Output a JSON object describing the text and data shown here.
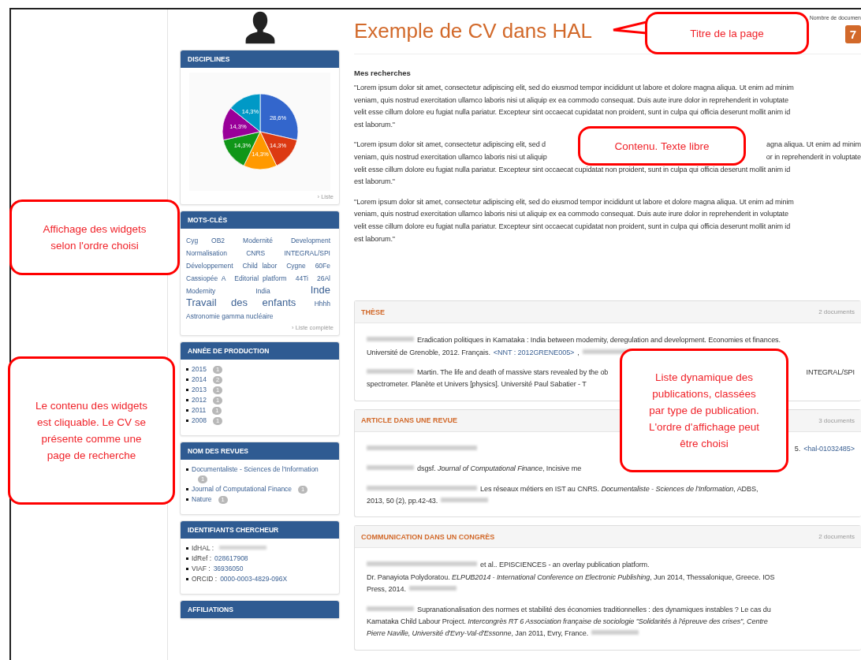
{
  "sidebar": {
    "widgets": [
      {
        "kind": "chart",
        "title": "DISCIPLINES",
        "chart_data": {
          "type": "pie",
          "values": [
            28.6,
            14.3,
            14.3,
            14.3,
            14.3,
            14.3
          ],
          "value_labels": [
            "28,6%",
            "14,3%",
            "14,3%",
            "14,3%",
            "14,3%",
            "14,3%"
          ]
        },
        "footer_link": "› Liste"
      },
      {
        "kind": "cloud",
        "title": "MOTS-CLÉS",
        "keywords": [
          {
            "text": "Cyg OB2",
            "kind": "small"
          },
          {
            "text": "Modernité",
            "kind": "small"
          },
          {
            "text": "Development",
            "kind": "small"
          },
          {
            "text": "Normalisation",
            "kind": "small"
          },
          {
            "text": "CNRS",
            "kind": "small"
          },
          {
            "text": "INTEGRAL/SPI",
            "kind": "small"
          },
          {
            "text": "Développement",
            "kind": "small"
          },
          {
            "text": "Child labor",
            "kind": "small"
          },
          {
            "text": "Cygne",
            "kind": "small"
          },
          {
            "text": "60Fe",
            "kind": "small"
          },
          {
            "text": "Cassiopée A",
            "kind": "small"
          },
          {
            "text": "Editorial platform",
            "kind": "small"
          },
          {
            "text": "44Ti",
            "kind": "small"
          },
          {
            "text": "26Al",
            "kind": "small"
          },
          {
            "text": "Modernity",
            "kind": "small"
          },
          {
            "text": "India",
            "kind": "small"
          },
          {
            "text": "Inde",
            "kind": "large"
          },
          {
            "text": "Travail des enfants",
            "kind": "large"
          },
          {
            "text": "Hhhh",
            "kind": "small"
          },
          {
            "text": "Astronomie gamma nucléaire",
            "kind": "small"
          }
        ],
        "footer_link": "› Liste complète"
      },
      {
        "kind": "facets",
        "title": "ANNÉE DE PRODUCTION",
        "items": [
          {
            "label": "2015",
            "count": "1"
          },
          {
            "label": "2014",
            "count": "2"
          },
          {
            "label": "2013",
            "count": "1"
          },
          {
            "label": "2012",
            "count": "1"
          },
          {
            "label": "2011",
            "count": "1"
          },
          {
            "label": "2008",
            "count": "1"
          }
        ]
      },
      {
        "kind": "facets",
        "title": "NOM DES REVUES",
        "items": [
          {
            "label": "Documentaliste - Sciences de l'Information",
            "count": "1"
          },
          {
            "label": "Journal of Computational Finance",
            "count": "1"
          },
          {
            "label": "Nature",
            "count": "1"
          }
        ]
      },
      {
        "kind": "ids",
        "title": "IDENTIFIANTS CHERCHEUR",
        "items": [
          {
            "label": "IdHAL :",
            "blurred": true
          },
          {
            "label": "IdRef :",
            "value": "028617908",
            "blurred": false
          },
          {
            "label": "VIAF :",
            "value": "36936050",
            "blurred": false
          },
          {
            "label": "ORCID :",
            "value": "0000-0003-4829-096X",
            "blurred": false
          }
        ]
      },
      {
        "kind": "header",
        "title": "AFFILIATIONS"
      }
    ]
  },
  "main": {
    "title": "Exemple de CV dans HAL",
    "doc_count_label": "Nombre de documen",
    "doc_count": "7",
    "section_title": "Mes recherches",
    "paragraphs": [
      {
        "lines": [
          [
            {
              "kind": "text",
              "text": "\"Lorem ipsum dolor sit amet, consectetur adipiscing elit, sed do eiusmod tempor incididunt ut labore et dolore magna aliqua. Ut enim ad minim"
            }
          ],
          [
            {
              "kind": "text",
              "text": "veniam, quis nostrud exercitation ullamco laboris nisi ut aliquip ex ea commodo consequat. Duis aute irure dolor in reprehenderit in voluptate"
            }
          ],
          [
            {
              "kind": "text",
              "text": "velit esse cillum dolore eu fugiat nulla pariatur. Excepteur sint occaecat cupidatat non proident, sunt in culpa qui officia deserunt mollit anim id"
            }
          ],
          [
            {
              "kind": "text",
              "text": "est laborum.\""
            }
          ]
        ]
      },
      {
        "lines": [
          [
            {
              "kind": "text",
              "text": "\"Lorem ipsum dolor sit amet, consectetur adipiscing elit, sed d"
            },
            {
              "kind": "tail",
              "text": "agna aliqua. Ut enim ad minim"
            }
          ],
          [
            {
              "kind": "text",
              "text": "veniam, quis nostrud exercitation ullamco laboris nisi ut aliquip"
            },
            {
              "kind": "tail",
              "text": "or in reprehenderit in voluptate"
            }
          ],
          [
            {
              "kind": "text",
              "text": "velit esse cillum dolore eu fugiat nulla pariatur. Excepteur sint occaecat cupidatat non proident, sunt in culpa qui officia deserunt mollit anim id"
            }
          ],
          [
            {
              "kind": "text",
              "text": "est laborum.\""
            }
          ]
        ]
      },
      {
        "lines": [
          [
            {
              "kind": "text",
              "text": "\"Lorem ipsum dolor sit amet, consectetur adipiscing elit, sed do eiusmod tempor incididunt ut labore et dolore magna aliqua. Ut enim ad minim"
            }
          ],
          [
            {
              "kind": "text",
              "text": "veniam, quis nostrud exercitation ullamco laboris nisi ut aliquip ex ea commodo consequat. Duis aute irure dolor in reprehenderit in voluptate"
            }
          ],
          [
            {
              "kind": "text",
              "text": "velit esse cillum dolore eu fugiat nulla pariatur. Excepteur sint occaecat cupidatat non proident, sunt in culpa qui officia deserunt mollit anim id"
            }
          ],
          [
            {
              "kind": "text",
              "text": "est laborum.\""
            }
          ]
        ]
      }
    ],
    "publication_groups": [
      {
        "title": "THÈSE",
        "count": "2 documents",
        "items": [
          {
            "lines": [
              [
                {
                  "kind": "blur"
                },
                {
                  "kind": "text",
                  "text": "Eradication politiques in Karnataka : India between modernity, deregulation and development. Economies et finances."
                }
              ],
              [
                {
                  "kind": "text",
                  "text": "Université de Grenoble, 2012. Français."
                },
                {
                  "kind": "link",
                  "text": "<NNT : 2012GRENE005>"
                },
                {
                  "kind": "text",
                  "text": ","
                },
                {
                  "kind": "blur"
                }
              ]
            ]
          },
          {
            "lines": [
              [
                {
                  "kind": "blur"
                },
                {
                  "kind": "text",
                  "text": "Martin. The life and death of massive stars revealed by the ob"
                },
                {
                  "kind": "tail",
                  "text": "INTEGRAL/SPI"
                }
              ],
              [
                {
                  "kind": "text",
                  "text": "spectrometer. Planète et Univers [physics]. Université Paul Sabatier - T"
                }
              ]
            ]
          }
        ]
      },
      {
        "title": "ARTICLE DANS UNE REVUE",
        "count": "3 documents",
        "items": [
          {
            "lines": [
              [
                {
                  "kind": "blur-long"
                },
                {
                  "kind": "tail",
                  "text": "5."
                },
                {
                  "kind": "link",
                  "text": "<hal-01032485>"
                }
              ]
            ]
          },
          {
            "lines": [
              [
                {
                  "kind": "blur"
                },
                {
                  "kind": "text",
                  "text": "dsgsf. *Journal of Computational Finance*, Incisive me"
                }
              ]
            ]
          },
          {
            "lines": [
              [
                {
                  "kind": "blur-long"
                },
                {
                  "kind": "text",
                  "text": "Les réseaux métiers en IST au CNRS. *Documentaliste - Sciences de l'Information*, ADBS,"
                }
              ],
              [
                {
                  "kind": "text",
                  "text": "2013, 50 (2), pp.42-43."
                },
                {
                  "kind": "blur"
                }
              ]
            ]
          }
        ]
      },
      {
        "title": "COMMUNICATION DANS UN CONGRÈS",
        "count": "2 documents",
        "items": [
          {
            "lines": [
              [
                {
                  "kind": "blur-long"
                },
                {
                  "kind": "text",
                  "text": "et al.. EPISCIENCES - an overlay publication platform."
                }
              ],
              [
                {
                  "kind": "text",
                  "text": "Dr. Panayiota Polydoratou. *ELPUB2014 - International Conference on Electronic Publishing*, Jun 2014, Thessalonique, Greece. IOS"
                }
              ],
              [
                {
                  "kind": "text",
                  "text": "Press, 2014."
                },
                {
                  "kind": "blur"
                }
              ]
            ]
          },
          {
            "lines": [
              [
                {
                  "kind": "blur"
                },
                {
                  "kind": "text",
                  "text": "Supranationalisation des normes et stabilité des économies traditionnelles : des dynamiques instables ? Le cas du"
                }
              ],
              [
                {
                  "kind": "text",
                  "text": "Karnataka Child Labour Project. *Intercongrès RT 6 Association française de sociologie \"Solidarités à l'épreuve des crises\", Centre*"
                }
              ],
              [
                {
                  "kind": "text",
                  "text": "*Pierre Naville, Université d'Evry-Val-d'Essonne*, Jan 2011, Evry, France."
                },
                {
                  "kind": "blur"
                }
              ]
            ]
          }
        ]
      }
    ]
  },
  "annotations": [
    {
      "text": "Titre de la page",
      "pointer": true
    },
    {
      "text": "Contenu. Texte libre",
      "pointer": false
    },
    {
      "text": "Affichage des widgets selon l'ordre choisi",
      "pointer": false
    },
    {
      "text": "Le contenu des widgets est cliquable. Le CV se présente comme une page de recherche",
      "pointer": false
    },
    {
      "text": "Liste dynamique des publications, classées par type de publication. L'ordre d'affichage peut être choisi",
      "pointer": false
    }
  ]
}
